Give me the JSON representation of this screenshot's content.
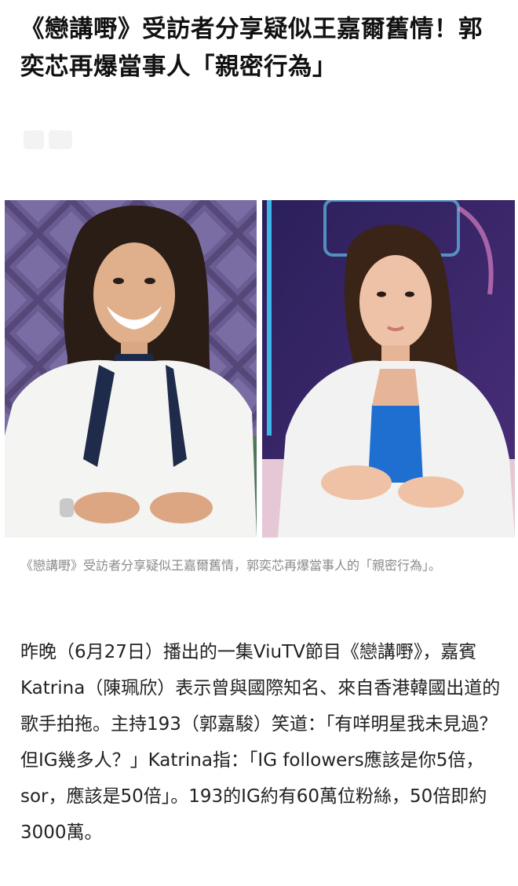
{
  "article": {
    "headline": "《戀講嘢》受訪者分享疑似王嘉爾舊情！郭奕芯再爆當事人「親密行為」",
    "photos": {
      "left_alt": "",
      "right_alt": ""
    },
    "caption": "《戀講嘢》受訪者分享疑似王嘉爾舊情，郭奕芯再爆當事人的「親密行為」。",
    "body": "昨晚（6月27日）播出的一集ViuTV節目《戀講嘢》，嘉賓Katrina（陳珮欣）表示曾與國際知名、來自香港韓國出道的歌手拍拖。主持193（郭嘉駿）笑道：「有咩明星我未見過？但IG幾多人？」Katrina指：「IG followers應該是你5倍，sor，應該是50倍」。193的IG約有60萬位粉絲，50倍即約3000萬。"
  },
  "colors": {
    "background": "#ffffff",
    "headline": "#111111",
    "caption": "#8a8a8a",
    "body": "#222222",
    "studio_purple": "#5b4a86",
    "studio_neon": "#3fd0ff",
    "blouse_white": "#f2f2f2",
    "top_blue": "#1f6fd1"
  }
}
